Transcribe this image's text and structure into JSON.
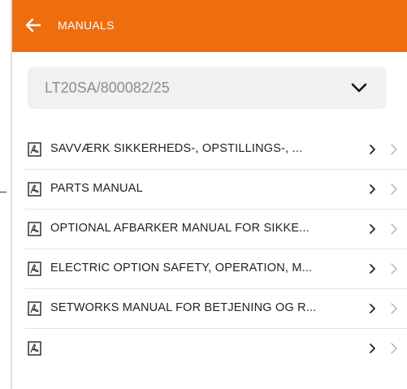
{
  "header": {
    "title": "MANUALS",
    "back_icon": "arrow-left-icon",
    "bg_color": "#ee6d0e"
  },
  "selector": {
    "value": "LT20SA/800082/25",
    "icon": "chevron-down-icon"
  },
  "manuals": [
    {
      "label": "SAVVÆRK SIKKERHEDS-, OPSTILLINGS-, ...",
      "icon": "pdf-icon"
    },
    {
      "label": "PARTS MANUAL",
      "icon": "pdf-icon"
    },
    {
      "label": "OPTIONAL AFBARKER MANUAL FOR SIKKE...",
      "icon": "pdf-icon"
    },
    {
      "label": "ELECTRIC OPTION SAFETY, OPERATION, M...",
      "icon": "pdf-icon"
    },
    {
      "label": "SETWORKS MANUAL FOR BETJENING OG R...",
      "icon": "pdf-icon"
    },
    {
      "label": "",
      "icon": "pdf-icon"
    }
  ]
}
